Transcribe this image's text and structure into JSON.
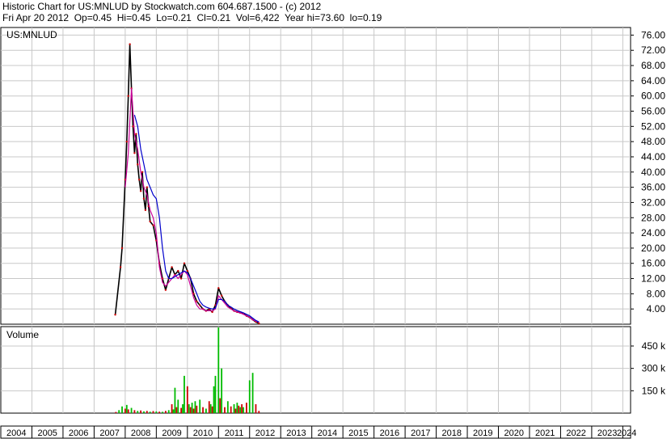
{
  "header": {
    "line1": "Historic Chart for US:MNLUD by Stockwatch.com 604.687.1500 - (c) 2012",
    "line2": "Fri Apr 20 2012  Op=0.45  Hi=0.45  Lo=0.21  Cl=0.21  Vol=6,422  Year hi=73.60  lo=0.19"
  },
  "chart_data": [
    {
      "type": "line",
      "title": "US:MNLUD",
      "y_ticks": [
        "76.00",
        "72.00",
        "68.00",
        "64.00",
        "60.00",
        "56.00",
        "52.00",
        "48.00",
        "44.00",
        "40.00",
        "36.00",
        "32.00",
        "28.00",
        "24.00",
        "20.00",
        "16.00",
        "12.00",
        "8.00",
        "4.00"
      ],
      "ylim": [
        0,
        78
      ],
      "x_ticks": [
        "2004",
        "2005",
        "2006",
        "2007",
        "2008",
        "2009",
        "2010",
        "2011",
        "2012",
        "2013",
        "2014",
        "2015",
        "2016",
        "2017",
        "2018",
        "2019",
        "2020",
        "2021",
        "2022",
        "2023",
        "2024"
      ],
      "xlim": [
        2004,
        2024.25
      ],
      "grid": true,
      "series": [
        {
          "role": "price",
          "color": "#000000",
          "x": [
            2007.68,
            2007.85,
            2007.9,
            2008.0,
            2008.05,
            2008.1,
            2008.15,
            2008.2,
            2008.25,
            2008.3,
            2008.35,
            2008.4,
            2008.45,
            2008.5,
            2008.55,
            2008.6,
            2008.65,
            2008.7,
            2008.75,
            2008.8,
            2008.9,
            2009.0,
            2009.1,
            2009.2,
            2009.3,
            2009.4,
            2009.5,
            2009.6,
            2009.7,
            2009.8,
            2009.9,
            2010.0,
            2010.1,
            2010.2,
            2010.3,
            2010.4,
            2010.5,
            2010.6,
            2010.7,
            2010.8,
            2010.9,
            2011.0,
            2011.1,
            2011.2,
            2011.3,
            2011.4,
            2011.5,
            2011.6,
            2011.7,
            2011.8,
            2011.9,
            2012.0,
            2012.1,
            2012.2,
            2012.3
          ],
          "y": [
            2.5,
            15.0,
            20.0,
            38.0,
            48.0,
            60.0,
            73.6,
            62.0,
            52.0,
            45.0,
            50.0,
            42.0,
            38.0,
            35.0,
            40.0,
            33.0,
            30.0,
            36.0,
            31.0,
            27.0,
            26.0,
            22.0,
            16.0,
            12.0,
            9.0,
            12.0,
            15.0,
            13.0,
            14.0,
            12.0,
            16.0,
            14.0,
            12.0,
            8.0,
            6.0,
            5.0,
            4.0,
            3.5,
            4.0,
            3.2,
            5.0,
            9.5,
            7.5,
            6.0,
            5.0,
            4.2,
            3.5,
            3.2,
            3.0,
            2.8,
            2.2,
            1.8,
            1.2,
            0.6,
            0.21
          ]
        },
        {
          "role": "moving-average",
          "color": "#cc0099",
          "x": [
            2008.0,
            2008.1,
            2008.2,
            2008.3,
            2008.4,
            2008.5,
            2008.6,
            2008.7,
            2008.8,
            2008.9,
            2009.0,
            2009.1,
            2009.2,
            2009.3,
            2009.4,
            2009.5,
            2009.6,
            2009.7,
            2009.8,
            2009.9,
            2010.0,
            2010.1,
            2010.2,
            2010.3,
            2010.4,
            2010.5,
            2010.6,
            2010.7,
            2010.8,
            2010.9,
            2011.0,
            2011.1,
            2011.2,
            2011.3,
            2011.4,
            2011.5,
            2011.6,
            2011.7,
            2011.8,
            2011.9,
            2012.0,
            2012.1,
            2012.2,
            2012.3
          ],
          "y": [
            36,
            45,
            62,
            50,
            46,
            40,
            36,
            34,
            30,
            28,
            24,
            15,
            11,
            10,
            11,
            12,
            13,
            12,
            13,
            14,
            13,
            10,
            7,
            5,
            4,
            4,
            3.5,
            3.6,
            3.5,
            4,
            7.5,
            6.5,
            5.5,
            4.5,
            4,
            3.5,
            3.2,
            3,
            2.6,
            2.2,
            1.8,
            1.2,
            0.8,
            0.5
          ]
        },
        {
          "role": "moving-average",
          "color": "#0000cc",
          "x": [
            2008.3,
            2008.4,
            2008.5,
            2008.6,
            2008.7,
            2008.8,
            2008.9,
            2009.0,
            2009.1,
            2009.2,
            2009.3,
            2009.4,
            2009.5,
            2009.6,
            2009.7,
            2009.8,
            2009.9,
            2010.0,
            2010.1,
            2010.2,
            2010.3,
            2010.4,
            2010.5,
            2010.6,
            2010.7,
            2010.8,
            2010.9,
            2011.0,
            2011.1,
            2011.2,
            2011.3,
            2011.4,
            2011.5,
            2011.6,
            2011.7,
            2011.8,
            2011.9,
            2012.0,
            2012.1,
            2012.2,
            2012.3
          ],
          "y": [
            55,
            52,
            46,
            42,
            38,
            36,
            34,
            33,
            28,
            20,
            14,
            12,
            12,
            12.5,
            13,
            13.5,
            14,
            13.5,
            12,
            10,
            8,
            6,
            5,
            4.5,
            4.2,
            4,
            4.2,
            6.5,
            6.5,
            6,
            5,
            4.5,
            4,
            3.6,
            3.3,
            3,
            2.6,
            2.2,
            1.6,
            1,
            0.6
          ]
        }
      ]
    },
    {
      "type": "bar",
      "title": "Volume",
      "y_ticks": [
        "450 k",
        "300 k",
        "150 k"
      ],
      "y_tick_values": [
        450000,
        300000,
        150000
      ],
      "ylim": [
        0,
        580000
      ],
      "x_ticks": [
        "2004",
        "2005",
        "2006",
        "2007",
        "2008",
        "2009",
        "2010",
        "2011",
        "2012",
        "2013",
        "2014",
        "2015",
        "2016",
        "2017",
        "2018",
        "2019",
        "2020",
        "2021",
        "2022",
        "2023",
        "2024"
      ],
      "xlim": [
        2004,
        2024.25
      ],
      "colors": {
        "up": "#00bb00",
        "down": "#cc0000"
      },
      "x": [
        2007.7,
        2007.8,
        2007.9,
        2008.0,
        2008.05,
        2008.1,
        2008.2,
        2008.3,
        2008.4,
        2008.5,
        2008.6,
        2008.7,
        2008.8,
        2008.9,
        2009.0,
        2009.1,
        2009.2,
        2009.3,
        2009.4,
        2009.5,
        2009.55,
        2009.6,
        2009.65,
        2009.7,
        2009.8,
        2009.85,
        2009.9,
        2010.0,
        2010.05,
        2010.1,
        2010.15,
        2010.2,
        2010.25,
        2010.3,
        2010.4,
        2010.5,
        2010.6,
        2010.7,
        2010.75,
        2010.8,
        2010.85,
        2010.9,
        2011.0,
        2011.05,
        2011.1,
        2011.2,
        2011.3,
        2011.4,
        2011.5,
        2011.55,
        2011.6,
        2011.65,
        2011.7,
        2011.75,
        2011.8,
        2011.9,
        2012.0,
        2012.1,
        2012.2,
        2012.3
      ],
      "values": [
        8000,
        20000,
        45000,
        30000,
        55000,
        25000,
        35000,
        20000,
        15000,
        18000,
        12000,
        15000,
        10000,
        14000,
        12000,
        10000,
        9000,
        15000,
        20000,
        60000,
        25000,
        170000,
        40000,
        90000,
        35000,
        60000,
        250000,
        180000,
        60000,
        40000,
        70000,
        30000,
        80000,
        50000,
        90000,
        40000,
        30000,
        80000,
        60000,
        45000,
        180000,
        250000,
        575000,
        100000,
        300000,
        40000,
        80000,
        45000,
        60000,
        30000,
        70000,
        50000,
        40000,
        60000,
        40000,
        70000,
        220000,
        270000,
        60000,
        15000
      ],
      "direction": [
        "down",
        "up",
        "up",
        "down",
        "up",
        "down",
        "up",
        "down",
        "up",
        "down",
        "up",
        "down",
        "up",
        "down",
        "up",
        "down",
        "up",
        "down",
        "up",
        "down",
        "up",
        "up",
        "down",
        "up",
        "down",
        "up",
        "up",
        "down",
        "up",
        "down",
        "up",
        "down",
        "up",
        "down",
        "up",
        "down",
        "up",
        "down",
        "up",
        "down",
        "up",
        "up",
        "up",
        "down",
        "up",
        "down",
        "up",
        "down",
        "up",
        "down",
        "up",
        "down",
        "up",
        "down",
        "up",
        "down",
        "up",
        "up",
        "down",
        "down"
      ]
    }
  ]
}
